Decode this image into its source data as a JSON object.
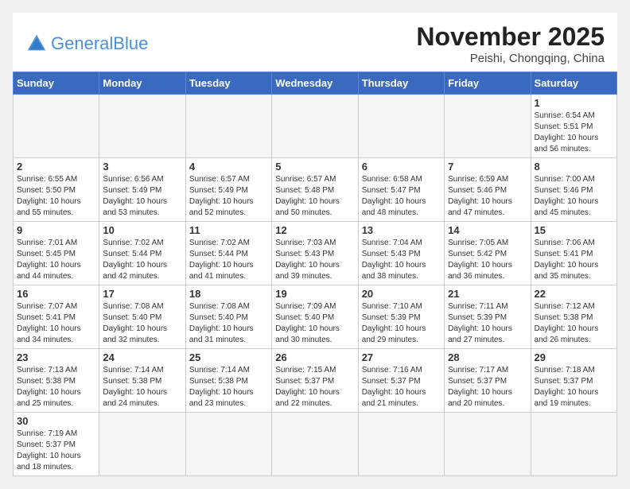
{
  "header": {
    "logo_general": "General",
    "logo_blue": "Blue",
    "month_year": "November 2025",
    "location": "Peishi, Chongqing, China"
  },
  "weekdays": [
    "Sunday",
    "Monday",
    "Tuesday",
    "Wednesday",
    "Thursday",
    "Friday",
    "Saturday"
  ],
  "weeks": [
    [
      {
        "day": "",
        "info": ""
      },
      {
        "day": "",
        "info": ""
      },
      {
        "day": "",
        "info": ""
      },
      {
        "day": "",
        "info": ""
      },
      {
        "day": "",
        "info": ""
      },
      {
        "day": "",
        "info": ""
      },
      {
        "day": "1",
        "info": "Sunrise: 6:54 AM\nSunset: 5:51 PM\nDaylight: 10 hours\nand 56 minutes."
      }
    ],
    [
      {
        "day": "2",
        "info": "Sunrise: 6:55 AM\nSunset: 5:50 PM\nDaylight: 10 hours\nand 55 minutes."
      },
      {
        "day": "3",
        "info": "Sunrise: 6:56 AM\nSunset: 5:49 PM\nDaylight: 10 hours\nand 53 minutes."
      },
      {
        "day": "4",
        "info": "Sunrise: 6:57 AM\nSunset: 5:49 PM\nDaylight: 10 hours\nand 52 minutes."
      },
      {
        "day": "5",
        "info": "Sunrise: 6:57 AM\nSunset: 5:48 PM\nDaylight: 10 hours\nand 50 minutes."
      },
      {
        "day": "6",
        "info": "Sunrise: 6:58 AM\nSunset: 5:47 PM\nDaylight: 10 hours\nand 48 minutes."
      },
      {
        "day": "7",
        "info": "Sunrise: 6:59 AM\nSunset: 5:46 PM\nDaylight: 10 hours\nand 47 minutes."
      },
      {
        "day": "8",
        "info": "Sunrise: 7:00 AM\nSunset: 5:46 PM\nDaylight: 10 hours\nand 45 minutes."
      }
    ],
    [
      {
        "day": "9",
        "info": "Sunrise: 7:01 AM\nSunset: 5:45 PM\nDaylight: 10 hours\nand 44 minutes."
      },
      {
        "day": "10",
        "info": "Sunrise: 7:02 AM\nSunset: 5:44 PM\nDaylight: 10 hours\nand 42 minutes."
      },
      {
        "day": "11",
        "info": "Sunrise: 7:02 AM\nSunset: 5:44 PM\nDaylight: 10 hours\nand 41 minutes."
      },
      {
        "day": "12",
        "info": "Sunrise: 7:03 AM\nSunset: 5:43 PM\nDaylight: 10 hours\nand 39 minutes."
      },
      {
        "day": "13",
        "info": "Sunrise: 7:04 AM\nSunset: 5:43 PM\nDaylight: 10 hours\nand 38 minutes."
      },
      {
        "day": "14",
        "info": "Sunrise: 7:05 AM\nSunset: 5:42 PM\nDaylight: 10 hours\nand 36 minutes."
      },
      {
        "day": "15",
        "info": "Sunrise: 7:06 AM\nSunset: 5:41 PM\nDaylight: 10 hours\nand 35 minutes."
      }
    ],
    [
      {
        "day": "16",
        "info": "Sunrise: 7:07 AM\nSunset: 5:41 PM\nDaylight: 10 hours\nand 34 minutes."
      },
      {
        "day": "17",
        "info": "Sunrise: 7:08 AM\nSunset: 5:40 PM\nDaylight: 10 hours\nand 32 minutes."
      },
      {
        "day": "18",
        "info": "Sunrise: 7:08 AM\nSunset: 5:40 PM\nDaylight: 10 hours\nand 31 minutes."
      },
      {
        "day": "19",
        "info": "Sunrise: 7:09 AM\nSunset: 5:40 PM\nDaylight: 10 hours\nand 30 minutes."
      },
      {
        "day": "20",
        "info": "Sunrise: 7:10 AM\nSunset: 5:39 PM\nDaylight: 10 hours\nand 29 minutes."
      },
      {
        "day": "21",
        "info": "Sunrise: 7:11 AM\nSunset: 5:39 PM\nDaylight: 10 hours\nand 27 minutes."
      },
      {
        "day": "22",
        "info": "Sunrise: 7:12 AM\nSunset: 5:38 PM\nDaylight: 10 hours\nand 26 minutes."
      }
    ],
    [
      {
        "day": "23",
        "info": "Sunrise: 7:13 AM\nSunset: 5:38 PM\nDaylight: 10 hours\nand 25 minutes."
      },
      {
        "day": "24",
        "info": "Sunrise: 7:14 AM\nSunset: 5:38 PM\nDaylight: 10 hours\nand 24 minutes."
      },
      {
        "day": "25",
        "info": "Sunrise: 7:14 AM\nSunset: 5:38 PM\nDaylight: 10 hours\nand 23 minutes."
      },
      {
        "day": "26",
        "info": "Sunrise: 7:15 AM\nSunset: 5:37 PM\nDaylight: 10 hours\nand 22 minutes."
      },
      {
        "day": "27",
        "info": "Sunrise: 7:16 AM\nSunset: 5:37 PM\nDaylight: 10 hours\nand 21 minutes."
      },
      {
        "day": "28",
        "info": "Sunrise: 7:17 AM\nSunset: 5:37 PM\nDaylight: 10 hours\nand 20 minutes."
      },
      {
        "day": "29",
        "info": "Sunrise: 7:18 AM\nSunset: 5:37 PM\nDaylight: 10 hours\nand 19 minutes."
      }
    ],
    [
      {
        "day": "30",
        "info": "Sunrise: 7:19 AM\nSunset: 5:37 PM\nDaylight: 10 hours\nand 18 minutes."
      },
      {
        "day": "",
        "info": ""
      },
      {
        "day": "",
        "info": ""
      },
      {
        "day": "",
        "info": ""
      },
      {
        "day": "",
        "info": ""
      },
      {
        "day": "",
        "info": ""
      },
      {
        "day": "",
        "info": ""
      }
    ]
  ]
}
